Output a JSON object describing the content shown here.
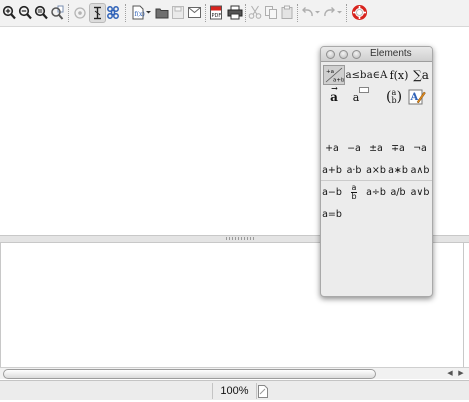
{
  "toolbar": {
    "items": [
      {
        "name": "zoom-in-icon",
        "icon": "magnifier-plus"
      },
      {
        "name": "zoom-out-icon",
        "icon": "magnifier-minus"
      },
      {
        "name": "zoom-100-icon",
        "icon": "magnifier-equals"
      },
      {
        "name": "show-all-icon",
        "icon": "magnifier-page"
      },
      {
        "name": "update-icon",
        "icon": "update-eye"
      },
      {
        "name": "formula-cursor-icon",
        "icon": "formula-cursor"
      },
      {
        "name": "symbols-icon",
        "icon": "place-of-interest"
      },
      {
        "name": "new-icon",
        "icon": "new-document"
      },
      {
        "name": "open-icon",
        "icon": "folder"
      },
      {
        "name": "save-icon",
        "icon": "floppy"
      },
      {
        "name": "email-icon",
        "icon": "envelope"
      },
      {
        "name": "export-pdf-icon",
        "icon": "pdf"
      },
      {
        "name": "print-icon",
        "icon": "printer"
      },
      {
        "name": "cut-icon",
        "icon": "scissors"
      },
      {
        "name": "copy-icon",
        "icon": "copy-pages"
      },
      {
        "name": "paste-icon",
        "icon": "clipboard"
      },
      {
        "name": "undo-icon",
        "icon": "undo-arrow"
      },
      {
        "name": "redo-icon",
        "icon": "redo-arrow"
      },
      {
        "name": "help-icon",
        "icon": "lifebuoy"
      }
    ]
  },
  "palette": {
    "title": "Elements",
    "categories_row1": [
      "a≤b",
      "a∈A",
      "f(x)",
      "∑a"
    ],
    "categories_row2_labels": {
      "vector": "a",
      "attribute_bubble": "a",
      "matrix_top": "a",
      "matrix_bottom": "b"
    },
    "elements": {
      "row1": [
        "+a",
        "−a",
        "±a",
        "∓a",
        "¬a"
      ],
      "row2": [
        "a+b",
        "a·b",
        "a×b",
        "a∗b",
        "a∧b"
      ],
      "row3_before": [
        "a−b"
      ],
      "row3_frac": {
        "num": "a",
        "den": "b"
      },
      "row3_after": [
        "a÷b",
        "a/b",
        "a∨b"
      ],
      "row4": [
        "a=b"
      ]
    }
  },
  "status": {
    "zoom": "100%"
  },
  "colors": {
    "toolbar_bg": "#f2f2f2",
    "palette_bg": "#ececec",
    "help_red": "#d8241e",
    "pen_orange": "#e08a1e",
    "blue": "#2f62b8"
  }
}
